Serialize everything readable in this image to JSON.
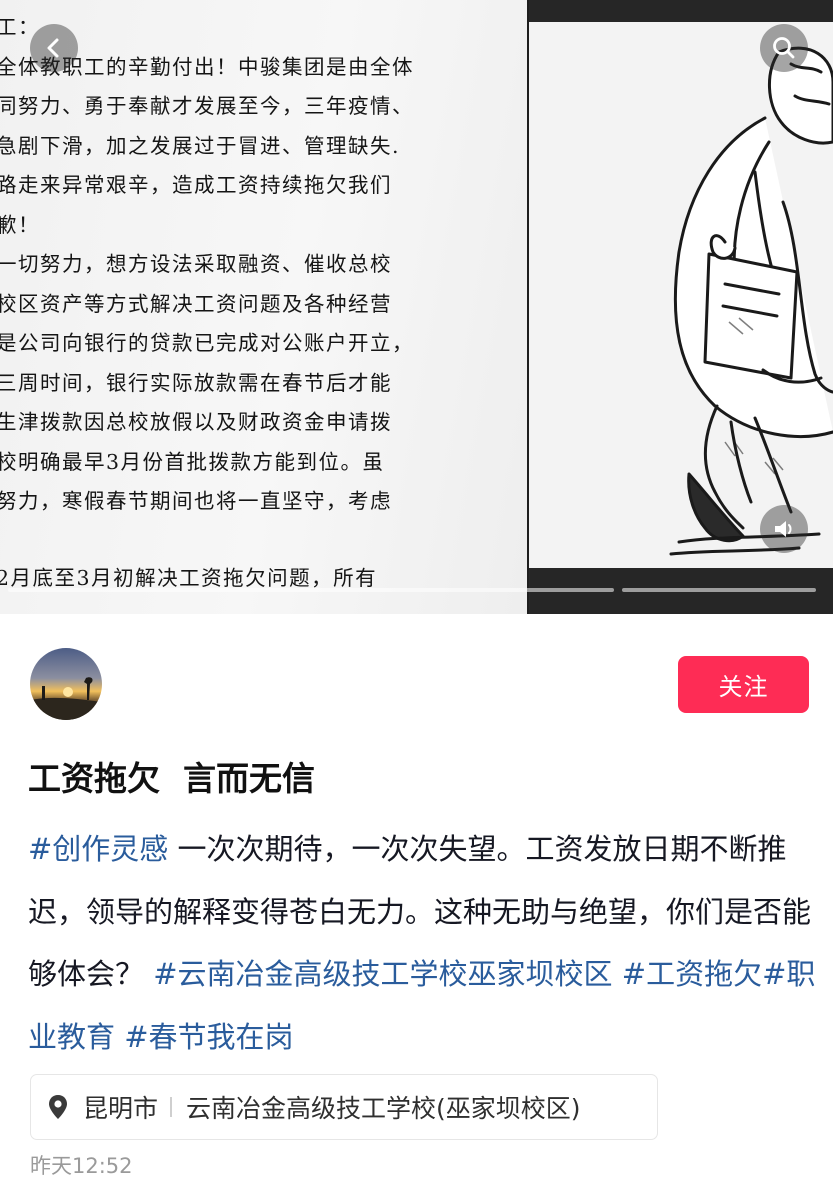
{
  "media": {
    "document_lines": [
      "工：",
      "全体教职工的辛勤付出！中骏集团是由全体",
      "同努力、勇于奉献才发展至今，三年疫情、",
      "急剧下滑，加之发展过于冒进、管理缺失.",
      "路走来异常艰辛，造成工资持续拖欠我们",
      "歉！",
      "一切努力，想方设法采取融资、催收总校",
      "校区资产等方式解决工资问题及各种经营",
      "是公司向银行的贷款已完成对公账户开立，",
      "三周时间，银行实际放款需在春节后才能",
      "生津拨款因总校放假以及财政资金申请拨",
      "校明确最早3月份首批拨款方能到位。虽",
      "努力，寒假春节期间也将一直坚守，考虑",
      "",
      "2月底至3月初解决工资拖欠问题，所有"
    ],
    "back_icon": "chevron-left-icon",
    "search_icon": "search-icon",
    "sound_icon": "speaker-icon",
    "slides": 2,
    "active_slide": 1
  },
  "author": {
    "follow_label": "关注"
  },
  "post": {
    "title": "工资拖欠  言而无信",
    "desc_tag1": "#创作灵感",
    "desc_text": " 一次次期待，一次次失望。工资发放日期不断推迟，领导的解释变得苍白无力。这种无助与绝望，你们是否能够体会？",
    "hashtags": [
      "#云南冶金高级技工学校巫家坝校区",
      "#工资拖欠",
      "#职业教育",
      "#春节我在岗"
    ],
    "location_city": "昆明市",
    "location_place": "云南冶金高级技工学校(巫家坝校区)",
    "location_icon": "map-pin-icon",
    "time": "昨天12:52"
  },
  "colors": {
    "follow_button": "#fe2c55",
    "hashtag": "#2a5c9c",
    "meta_text": "#9a9a9a"
  }
}
